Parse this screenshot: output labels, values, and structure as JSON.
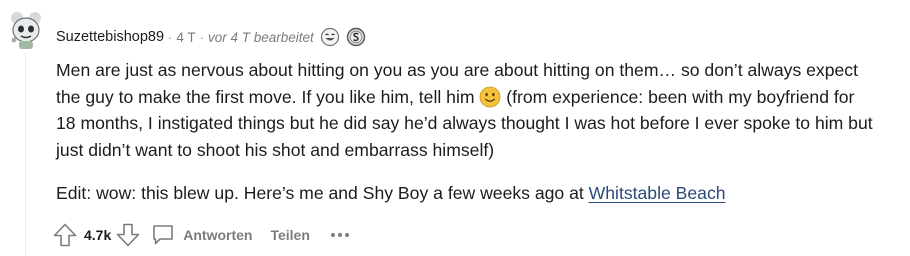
{
  "comment": {
    "author": "Suzettebishop89",
    "separator": "·",
    "time": "4 T",
    "edited": "vor 4 T bearbeitet",
    "paragraphs": {
      "p1_before_emoji": "Men are just as nervous about hitting on you as you are about hitting on them… so don’t always expect the guy to make the first move. If you like him, tell him ",
      "p1_after_emoji": " (from experience: been with my boyfriend for 18 months, I instigated things but he did say he’d always thought I was hot before I ever spoke to him but just didn’t want to shoot his shot and embarrass himself)",
      "p2_before_link": "Edit: wow: this blew up. Here’s me and Shy Boy a few weeks ago at ",
      "p2_link": "Whitstable Beach"
    }
  },
  "actions": {
    "score": "4.7k",
    "reply_label": "Antworten",
    "share_label": "Teilen"
  },
  "icons": {
    "avatar": "snoo-avatar-icon",
    "award1": "laughing-award-icon",
    "award2": "silver-award-icon",
    "emoji": "slightly-smiling-face-icon",
    "upvote": "upvote-arrow-icon",
    "downvote": "downvote-arrow-icon",
    "reply": "speech-bubble-icon",
    "more": "ellipsis-icon"
  },
  "colors": {
    "link": "#2b4a7a",
    "muted": "#7c7c7c",
    "emoji": "#f7c23a"
  }
}
